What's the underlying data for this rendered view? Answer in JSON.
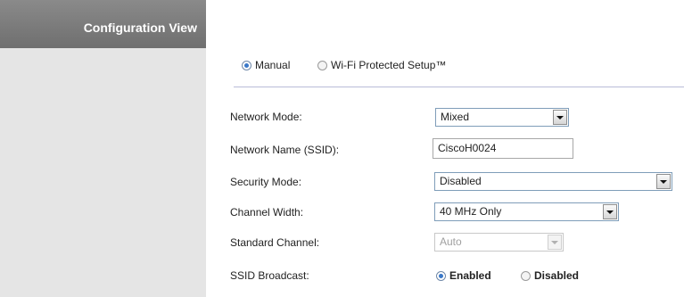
{
  "sidebar": {
    "title": "Configuration View"
  },
  "setup_mode": {
    "options": [
      {
        "label": "Manual",
        "checked": true
      },
      {
        "label": "Wi-Fi Protected Setup™",
        "checked": false
      }
    ]
  },
  "form": {
    "network_mode": {
      "label": "Network Mode:",
      "value": "Mixed"
    },
    "ssid": {
      "label": "Network Name (SSID):",
      "value": "CiscoH0024"
    },
    "security_mode": {
      "label": "Security Mode:",
      "value": "Disabled"
    },
    "channel_width": {
      "label": "Channel Width:",
      "value": "40 MHz Only"
    },
    "standard_channel": {
      "label": "Standard Channel:",
      "value": "Auto",
      "disabled": true
    },
    "ssid_broadcast": {
      "label": "SSID Broadcast:",
      "options": [
        {
          "label": "Enabled",
          "checked": true
        },
        {
          "label": "Disabled",
          "checked": false
        }
      ]
    }
  },
  "icons": {
    "radio": "radio-button-icon",
    "dropdown": "chevron-down-icon"
  },
  "colors": {
    "sidebar_header": "#7d7d7d",
    "sidebar_body": "#e5e5e5",
    "divider": "#b9bcd8",
    "radio_selected": "#3a78c8"
  }
}
